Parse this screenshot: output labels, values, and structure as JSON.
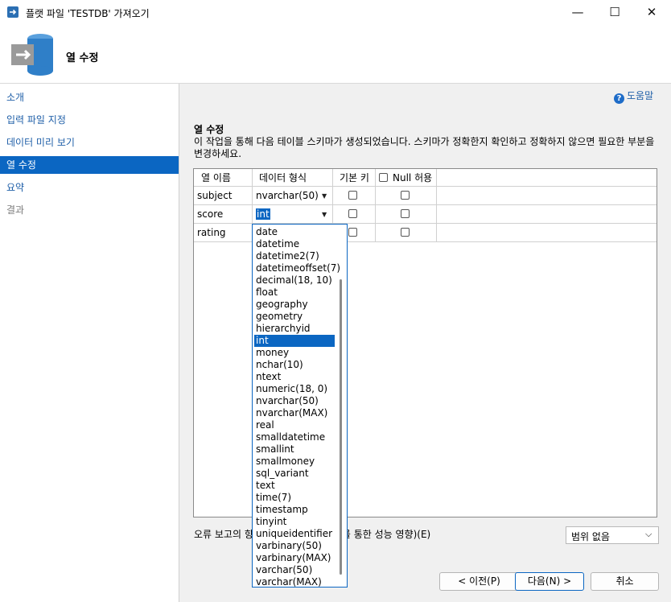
{
  "window": {
    "title": "플랫 파일 'TESTDB' 가져오기",
    "minimize": "—",
    "maximize": "☐",
    "close": "✕"
  },
  "header": {
    "title": "열 수정"
  },
  "sidebar": {
    "items": [
      {
        "label": "소개",
        "state": "link"
      },
      {
        "label": "입력 파일 지정",
        "state": "link"
      },
      {
        "label": "데이터 미리 보기",
        "state": "link"
      },
      {
        "label": "열 수정",
        "state": "active"
      },
      {
        "label": "요약",
        "state": "link"
      },
      {
        "label": "결과",
        "state": "disabled"
      }
    ]
  },
  "help": {
    "icon": "?",
    "label": "도움말"
  },
  "main": {
    "section_title": "열 수정",
    "description": "이 작업을 통해 다음 테이블 스키마가 생성되었습니다. 스키마가 정확한지 확인하고 정확하지 않으면 필요한 부분을 변경하세요."
  },
  "grid": {
    "headers": {
      "column_name": "열 이름",
      "data_type": "데이터 형식",
      "primary_key": "기본 키",
      "allow_null": "Null 허용"
    },
    "rows": [
      {
        "name": "subject",
        "type": "nvarchar(50)"
      },
      {
        "name": "score",
        "type": "int"
      },
      {
        "name": "rating",
        "type": ""
      }
    ]
  },
  "dropdown": {
    "selected": "int",
    "options": [
      "date",
      "datetime",
      "datetime2(7)",
      "datetimeoffset(7)",
      "decimal(18, 10)",
      "float",
      "geography",
      "geometry",
      "hierarchyid",
      "int",
      "money",
      "nchar(10)",
      "ntext",
      "numeric(18, 0)",
      "nvarchar(50)",
      "nvarchar(MAX)",
      "real",
      "smalldatetime",
      "smallint",
      "smallmoney",
      "sql_variant",
      "text",
      "time(7)",
      "timestamp",
      "tinyint",
      "uniqueidentifier",
      "varbinary(50)",
      "varbinary(MAX)",
      "varchar(50)",
      "varchar(MAX)"
    ]
  },
  "footer": {
    "error_label_start": "오류 보고의 향",
    "error_label_end": "를 통한 성능 영향)(E)",
    "error_scope_value": "범위 없음"
  },
  "buttons": {
    "prev": "< 이전(P)",
    "next": "다음(N) >",
    "cancel": "취소"
  },
  "colors": {
    "accent": "#0b66c2",
    "link": "#1f5fa8"
  }
}
